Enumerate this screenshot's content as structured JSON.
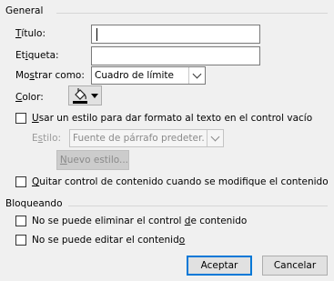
{
  "general": {
    "section_title": "General",
    "title_label_u": "T",
    "title_label_rest": "ítulo:",
    "tag_label_a": "Et",
    "tag_label_u": "i",
    "tag_label_b": "queta:",
    "show_as_label_a": "Mo",
    "show_as_label_u": "s",
    "show_as_label_b": "trar como:",
    "show_as_value": "Cuadro de límite",
    "color_label_u": "C",
    "color_label_rest": "olor:",
    "use_style_u": "U",
    "use_style_rest": "sar un estilo para dar formato al texto en el control vacío",
    "style_label_a": "E",
    "style_label_u": "s",
    "style_label_b": "tilo:",
    "style_value": "Fuente de párrafo predeter.",
    "new_style_u": "N",
    "new_style_rest": "uevo estilo...",
    "remove_u": "Q",
    "remove_rest": "uitar control de contenido cuando se modifique el contenido"
  },
  "locking": {
    "section_title": "Bloqueando",
    "no_delete_a": "No se puede eliminar el control ",
    "no_delete_u": "d",
    "no_delete_b": "e contenido",
    "no_edit_a": "No se puede editar el contenid",
    "no_edit_u": "o"
  },
  "buttons": {
    "accept": "Aceptar",
    "cancel": "Cancelar"
  },
  "colors": {
    "accent": "#0078d7",
    "disabled_text": "#9a9a9a"
  },
  "icons": {
    "color_picker": "paint-bucket-icon",
    "dropdown": "chevron-down-icon"
  }
}
